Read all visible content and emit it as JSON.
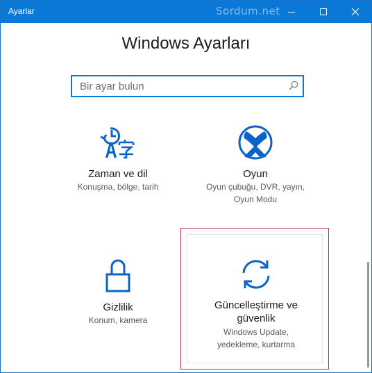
{
  "window": {
    "title": "Ayarlar",
    "watermark": "Sordum.net",
    "accent_color": "#0a78d7"
  },
  "header": {
    "title": "Windows Ayarları"
  },
  "search": {
    "placeholder": "Bir ayar bulun",
    "icon": "search-icon"
  },
  "tiles": [
    {
      "icon": "time-language-icon",
      "title": "Zaman ve dil",
      "description": "Konuşma, bölge, tarih"
    },
    {
      "icon": "xbox-icon",
      "title": "Oyun",
      "description_line1": "Oyun çubuğu, DVR, yayın,",
      "description_line2": "Oyun Modu"
    },
    {
      "icon": "lock-icon",
      "title": "Gizlilik",
      "description": "Konum, kamera"
    },
    {
      "icon": "sync-icon",
      "title_line1": "Güncelleştirme ve",
      "title_line2": "güvenlik",
      "description_line1": "Windows Update,",
      "description_line2": "yedekleme, kurtarma",
      "highlighted": true,
      "highlight_color": "#b8324a"
    }
  ]
}
